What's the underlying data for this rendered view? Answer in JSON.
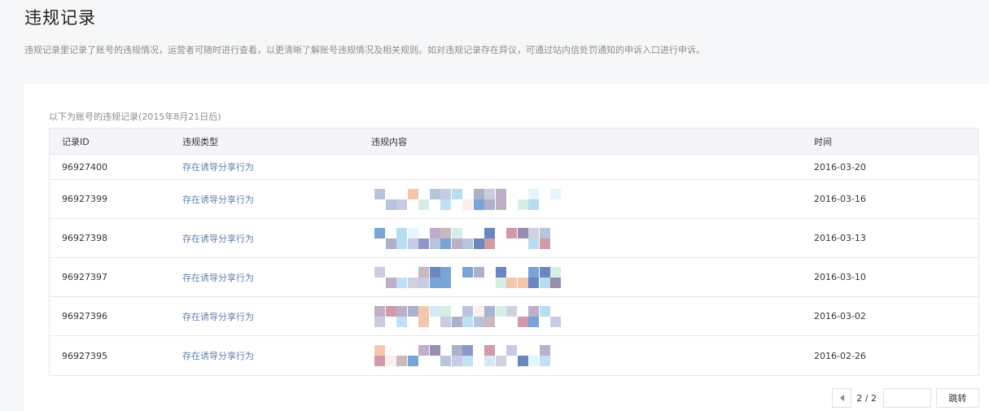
{
  "page": {
    "title": "违规记录",
    "description": "违规记录里记录了账号的违规情况，运营者可随时进行查看，以更清晰了解账号违规情况及相关规则。如对违规记录存在异议，可通过站内信处罚通知的申诉入口进行申诉。"
  },
  "table": {
    "caption": "以下为账号的违规记录(2015年8月21日后)",
    "headers": [
      "记录ID",
      "违规类型",
      "违规内容",
      "时间"
    ],
    "rows": [
      {
        "id": "96927400",
        "type": "存在诱导分享行为",
        "content": "",
        "time": "2016-03-20"
      },
      {
        "id": "96927399",
        "type": "存在诱导分享行为",
        "content": "",
        "time": "2016-03-16"
      },
      {
        "id": "96927398",
        "type": "存在诱导分享行为",
        "content": "",
        "time": "2016-03-13"
      },
      {
        "id": "96927397",
        "type": "存在诱导分享行为",
        "content": "",
        "time": "2016-03-10"
      },
      {
        "id": "96927396",
        "type": "存在诱导分享行为",
        "content": "",
        "time": "2016-03-02"
      },
      {
        "id": "96927395",
        "type": "存在诱导分享行为",
        "content": "",
        "time": "2016-02-26"
      }
    ]
  },
  "pagination": {
    "page_indicator": "2 / 2",
    "input_value": "",
    "jump_label": "跳转"
  },
  "colors": {
    "link": "#607fa6",
    "border": "#e7e7eb",
    "header_bg": "#f4f5f9"
  }
}
